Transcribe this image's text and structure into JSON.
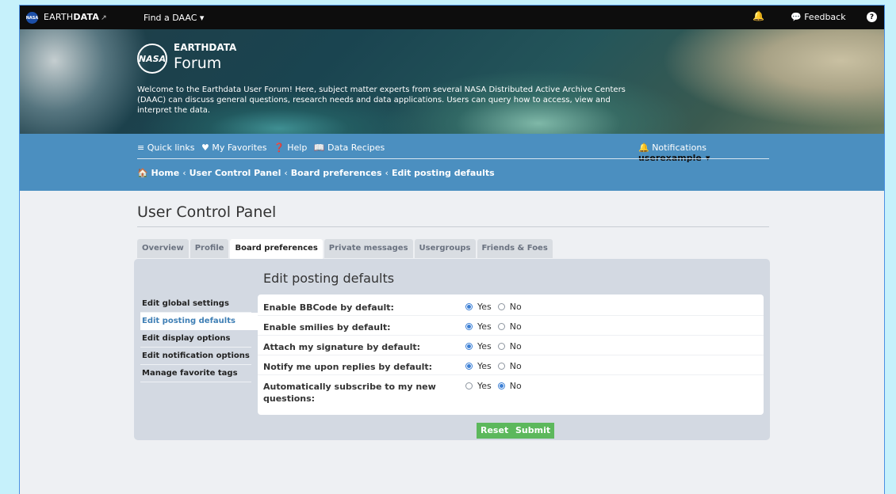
{
  "topbar": {
    "nasa_mini": "NASA",
    "brand_left": "EARTH",
    "brand_right": "DATA",
    "ext_glyph": "↗",
    "find_daac": "Find a DAAC ▾",
    "bell_glyph": "🔔",
    "feedback": "Feedback",
    "help_glyph": "?"
  },
  "hero": {
    "nasa_logo": "NASA",
    "brand": "EARTHDATA",
    "title": "Forum",
    "description": "Welcome to the Earthdata User Forum! Here, subject matter experts from several NASA Distributed Active Archive Centers (DAAC) can discuss general questions, research needs and data applications. Users can query how to access, view and interpret the data."
  },
  "nav": {
    "quick_links": "≡ Quick links",
    "favorites": "♥ My Favorites",
    "help": "❓ Help",
    "recipes": "📖 Data Recipes",
    "notifications": "🔔 Notifications",
    "username": "userexample",
    "user_caret": "▾"
  },
  "breadcrumb": [
    "🏠 Home",
    "User Control Panel",
    "Board preferences",
    "Edit posting defaults"
  ],
  "breadcrumb_sep": "‹",
  "page": {
    "title": "User Control Panel"
  },
  "tabs": [
    "Overview",
    "Profile",
    "Board preferences",
    "Private messages",
    "Usergroups",
    "Friends & Foes"
  ],
  "side_menu": [
    "Edit global settings",
    "Edit posting defaults",
    "Edit display options",
    "Edit notification options",
    "Manage favorite tags"
  ],
  "form": {
    "title": "Edit posting defaults",
    "yes_label": "Yes",
    "no_label": "No",
    "rows": [
      {
        "label": "Enable BBCode by default:",
        "value": "Yes"
      },
      {
        "label": "Enable smilies by default:",
        "value": "Yes"
      },
      {
        "label": "Attach my signature by default:",
        "value": "Yes"
      },
      {
        "label": "Notify me upon replies by default:",
        "value": "Yes"
      },
      {
        "label": "Automatically subscribe to my new questions:",
        "value": "No"
      }
    ],
    "reset_label": "Reset",
    "submit_label": "Submit"
  },
  "colors": {
    "topbar": "#0d0d0d",
    "navbar": "#4b8fc0",
    "button": "#5cb85c",
    "radio_selected": "#3b7fd5",
    "outer_background": "#c6f1fb"
  }
}
